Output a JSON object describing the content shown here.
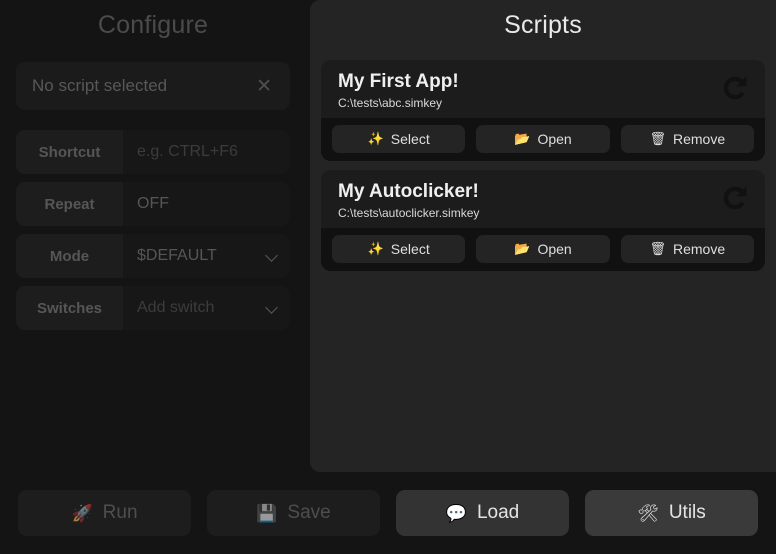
{
  "configure": {
    "title": "Configure",
    "selected_script": {
      "value": "No script selected",
      "clear_icon": "close-icon",
      "clear_glyph": "✕"
    },
    "rows": [
      {
        "label": "Shortcut",
        "value": "e.g. CTRL+F6",
        "is_placeholder": true,
        "has_chevron": false
      },
      {
        "label": "Repeat",
        "value": "OFF",
        "is_placeholder": false,
        "has_chevron": false
      },
      {
        "label": "Mode",
        "value": "$DEFAULT",
        "is_placeholder": false,
        "has_chevron": true
      },
      {
        "label": "Switches",
        "value": "Add switch",
        "is_placeholder": true,
        "has_chevron": true
      }
    ]
  },
  "scripts": {
    "title": "Scripts",
    "items": [
      {
        "name": "My First App!",
        "path": "C:\\tests\\abc.simkey",
        "reload_icon": "reload-icon",
        "actions": [
          {
            "label": "Select",
            "icon": "sparkles-icon",
            "glyph": "✨"
          },
          {
            "label": "Open",
            "icon": "open-folder-icon",
            "glyph": "📂"
          },
          {
            "label": "Remove",
            "icon": "trash-icon",
            "glyph": "🗑"
          }
        ]
      },
      {
        "name": "My Autoclicker!",
        "path": "C:\\tests\\autoclicker.simkey",
        "reload_icon": "reload-icon",
        "actions": [
          {
            "label": "Select",
            "icon": "sparkles-icon",
            "glyph": "✨"
          },
          {
            "label": "Open",
            "icon": "open-folder-icon",
            "glyph": "📂"
          },
          {
            "label": "Remove",
            "icon": "trash-icon",
            "glyph": "🗑"
          }
        ]
      }
    ]
  },
  "bottom_bar": {
    "buttons": [
      {
        "label": "Run",
        "icon": "rocket-icon",
        "glyph": "🚀",
        "state": "disabled"
      },
      {
        "label": "Save",
        "icon": "floppy-disk-icon",
        "glyph": "💾",
        "state": "disabled"
      },
      {
        "label": "Load",
        "icon": "speech-balloon-icon",
        "glyph": "💬",
        "state": "enabled"
      },
      {
        "label": "Utils",
        "icon": "hammer-and-wrench-icon",
        "glyph": "🛠",
        "state": "enabled-light"
      }
    ]
  },
  "colors": {
    "page_background": "#141414",
    "scripts_panel_background": "#242424",
    "card_background": "#1c1c1c",
    "card_actions_background": "#111111",
    "accent_text": "#e9e9e9",
    "muted_text": "#565656"
  }
}
